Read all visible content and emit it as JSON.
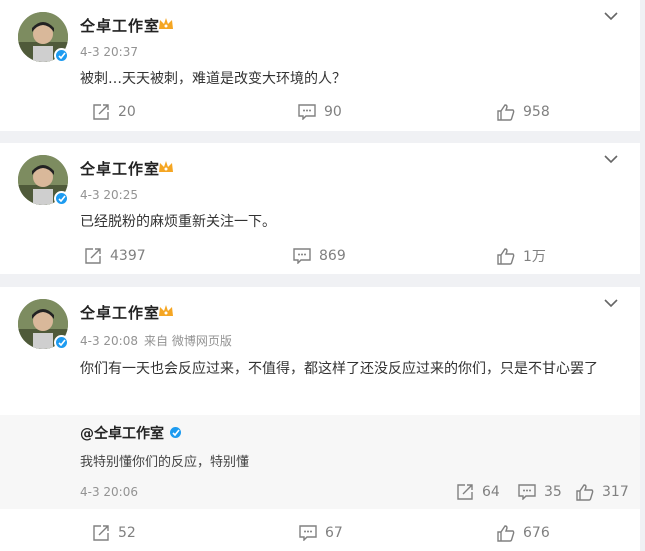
{
  "posts": [
    {
      "author": "仝卓工作室",
      "time": "4-3 20:37",
      "source": "",
      "text": "被刺…天天被刺，难道是改变大环境的人？",
      "repost_count": "20",
      "comment_count": "90",
      "like_count": "958"
    },
    {
      "author": "仝卓工作室",
      "time": "4-3 20:25",
      "source": "",
      "text": "已经脱粉的麻烦重新关注一下。",
      "repost_count": "4397",
      "comment_count": "869",
      "like_count": "1万"
    },
    {
      "author": "仝卓工作室",
      "time": "4-3 20:08",
      "source": "来自 微博网页版",
      "text": "你们有一天也会反应过来，不值得，都这样了还没反应过来的你们，只是不甘心罢了",
      "quoted": {
        "author": "@仝卓工作室",
        "text": "我特别懂你们的反应，特别懂",
        "time": "4-3 20:06",
        "repost_count": "64",
        "comment_count": "35",
        "like_count": "317"
      },
      "repost_count": "52",
      "comment_count": "67",
      "like_count": "676"
    }
  ],
  "colors": {
    "verified": "#1d9bf0",
    "crown": "#f5a623"
  },
  "icons": [
    "chevron-down-icon",
    "verified-icon",
    "crown-icon",
    "repost-icon",
    "comment-icon",
    "like-icon"
  ]
}
